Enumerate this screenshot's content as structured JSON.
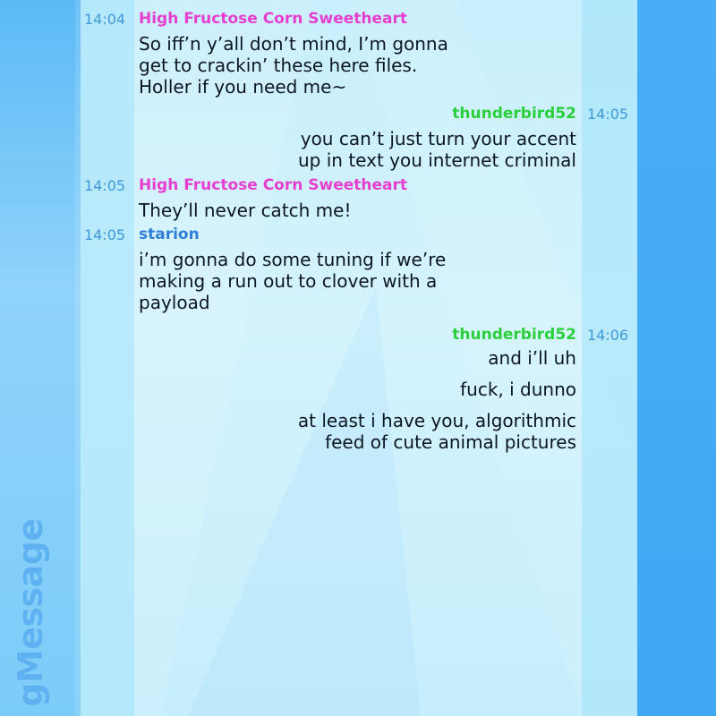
{
  "app": {
    "brand": "gMessage"
  },
  "colors": {
    "pink_user": "#e63fd0",
    "green_user": "#2bcf3b",
    "blue_user": "#2f7ed8",
    "timestamp": "#3f99d8"
  },
  "messages": [
    {
      "time": "14:04",
      "author": "High Fructose Corn Sweetheart",
      "side": "left",
      "lines": [
        "So iff’n y’all don’t mind, I’m gonna",
        "get to crackin’ these here files.",
        "Holler if you need me~"
      ]
    },
    {
      "time": "14:05",
      "author": "thunderbird52",
      "side": "right",
      "lines": [
        "you can’t just turn your accent",
        "up in text you internet criminal"
      ]
    },
    {
      "time": "14:05",
      "author": "High Fructose Corn Sweetheart",
      "side": "left",
      "lines": [
        "They’ll never catch me!"
      ]
    },
    {
      "time": "14:05",
      "author": "starion",
      "side": "left",
      "lines": [
        "i’m gonna do some tuning if we’re",
        "making a run out to clover with a",
        "payload"
      ]
    },
    {
      "time": "14:06",
      "author": "thunderbird52",
      "side": "right",
      "lines": [
        "and i’ll uh"
      ],
      "followups": [
        [
          "fuck, i dunno"
        ],
        [
          "at least i have you, algorithmic",
          "feed of cute animal pictures"
        ]
      ]
    }
  ]
}
